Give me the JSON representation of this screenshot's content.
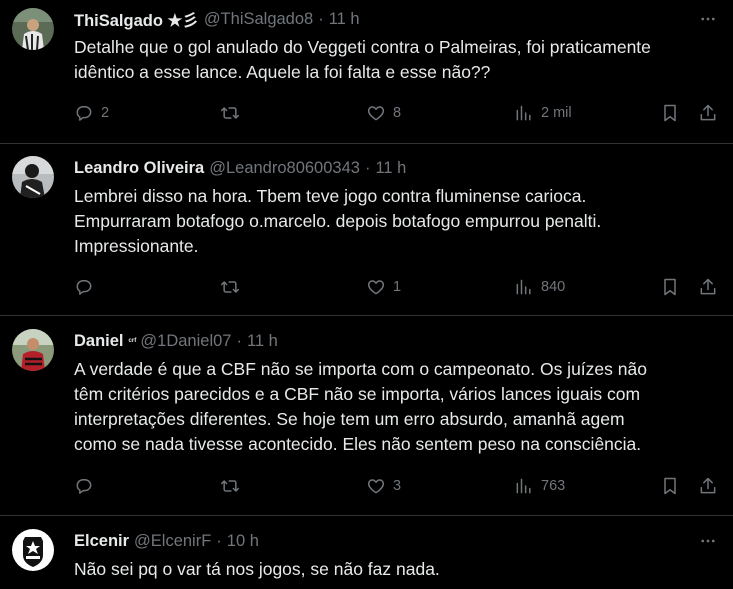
{
  "tweets": [
    {
      "name": "ThiSalgado ★彡",
      "handle": "@ThiSalgado8",
      "time": "11 h",
      "text": "Detalhe que o gol anulado do Veggeti contra o Palmeiras, foi praticamente\nidêntico a esse lance. Aquele la foi falta e esse não??",
      "replies": "2",
      "retweets": "",
      "likes": "8",
      "views": "2 mil"
    },
    {
      "name": "Leandro Oliveira",
      "handle": "@Leandro80600343",
      "time": "11 h",
      "text": "Lembrei disso na hora. Tbem teve jogo contra fluminense carioca.\nEmpurraram botafogo o.marcelo. depois botafogo empurrou penalti.\nImpressionante.",
      "replies": "",
      "retweets": "",
      "likes": "1",
      "views": "840"
    },
    {
      "name": "Daniel",
      "badge": "ᶜʳᶠ",
      "handle": "@1Daniel07",
      "time": "11 h",
      "text": "A verdade é que a CBF não se importa com o campeonato. Os juízes não\ntêm critérios parecidos e a CBF não se importa, vários lances iguais com\ninterpretações diferentes. Se hoje tem um erro absurdo, amanhã agem\ncomo se nada tivesse acontecido. Eles não sentem peso na consciência.",
      "replies": "",
      "retweets": "",
      "likes": "3",
      "views": "763"
    },
    {
      "name": "Elcenir",
      "handle": "@ElcenirF",
      "time": "10 h",
      "text": "Não sei pq o var tá nos jogos, se não faz nada."
    }
  ],
  "icons": {
    "reply": "reply-icon",
    "retweet": "retweet-icon",
    "like": "heart-icon",
    "views": "views-icon",
    "bookmark": "bookmark-icon",
    "share": "share-icon",
    "more": "more-icon"
  },
  "colors": {
    "background": "#000000",
    "text": "#e7e9ea",
    "muted": "#71767b",
    "divider": "#2f3336"
  }
}
